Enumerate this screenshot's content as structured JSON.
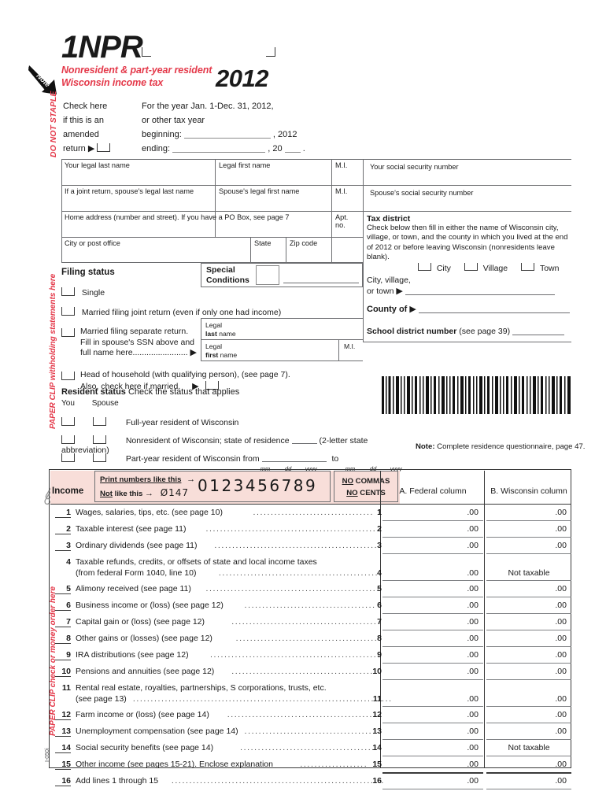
{
  "form": {
    "number": "1NPR",
    "subtitle_line1": "Nonresident & part-year resident",
    "subtitle_line2": "Wisconsin income tax",
    "tax_year": "2012",
    "note_badge": "Note",
    "form_id": "I-050i"
  },
  "margins": {
    "do_not_staple": "DO NOT STAPLE",
    "paper_clip_withholding": "PAPER CLIP withholding statements here",
    "paper_clip_check": "PAPER CLIP check or money order here"
  },
  "amended": {
    "line1": "Check here",
    "line2": "if this is an",
    "line3": "amended",
    "line4": "return"
  },
  "period": {
    "line1": "For the year Jan. 1-Dec. 31, 2012,",
    "line2": "or other tax year",
    "beginning_label": "beginning:",
    "beginning_year": ", 2012",
    "ending_label": "ending:",
    "ending_year": ", 20",
    "ending_period": "."
  },
  "identity": {
    "your_last_name": "Your legal last name",
    "legal_first_name": "Legal first name",
    "mi": "M.I.",
    "spouse_last_name": "If a joint return, spouse's legal last name",
    "spouse_first_name": "Spouse's legal first name",
    "spouse_mi": "M.I.",
    "home_address": "Home address (number and street). If you have a PO Box, see page 7",
    "apt_no": "Apt. no.",
    "city_or_post_office": "City or post office",
    "state": "State",
    "zip_code": "Zip code"
  },
  "ssn": {
    "your_ssn": "Your social security number",
    "spouse_ssn": "Spouse's social security number"
  },
  "tax_district": {
    "title": "Tax district",
    "description": "Check below then fill in either the name of Wisconsin city, village, or town, and the county in which you lived at the end of 2012 or before leaving Wisconsin (nonresidents leave blank).",
    "option_city": "City",
    "option_village": "Village",
    "option_town": "Town",
    "city_village_town_label_line1": "City, village,",
    "city_village_town_label_line2": "or town",
    "county_of": "County of",
    "school_district_label": "School district number",
    "school_district_note": "(see page 39)"
  },
  "filing_status": {
    "title": "Filing status",
    "options": [
      "Single",
      "Married filing joint return (even if only one had income)",
      "Married filing separate return.",
      "Head of household (with qualifying person), (see page 7)."
    ],
    "mfs_line2": "Fill in spouse's SSN above and",
    "mfs_line3": "full name here",
    "mfs_dots": "........................",
    "hoh_line2": "Also, check here if married.",
    "spouse_legal_last_word": "Legal",
    "spouse_last_bold": "last",
    "spouse_last_rest": " name",
    "spouse_legal_first_word": "Legal",
    "spouse_first_bold": "first",
    "spouse_first_rest": " name",
    "spouse_mi": "M.I."
  },
  "special_conditions": {
    "label_line1": "Special",
    "label_line2": "Conditions"
  },
  "resident_status": {
    "title": "Resident status",
    "subtitle": "Check the status that applies",
    "col_you": "You",
    "col_spouse": "Spouse",
    "row_full": "Full-year resident of Wisconsin",
    "row_nonresident": "Nonresident of Wisconsin; state of residence",
    "row_nonresident_suffix": "(2-letter state abbreviation)",
    "row_partyear": "Part-year resident of Wisconsin from",
    "row_partyear_to": "to",
    "date_mm": "mm",
    "date_dd": "dd",
    "date_yyyy": "yyyy",
    "note_bold": "Note:",
    "note_text": " Complete residence questionnaire, page 47."
  },
  "income_header": {
    "section_label": "Income",
    "sample_line1_bold": "Print numbers like this",
    "sample_line2_prefix": "Not",
    "sample_line2_rest": " like this",
    "sample_bad": "Ø147",
    "sample_digits": "0123456789",
    "no_commas_line1_ul": "NO",
    "no_commas_line1_rest": " COMMAS",
    "no_commas_line2_ul": "NO",
    "no_commas_line2_rest": " CENTS",
    "column_a": "A. Federal column",
    "column_b": "B. Wisconsin column"
  },
  "income_rows": [
    {
      "no": "1",
      "text": "Wages, salaries, tips, etc. (see page 10)",
      "a": ".00",
      "b": ".00",
      "lines": 1
    },
    {
      "no": "2",
      "text": "Taxable interest (see page 11)",
      "a": ".00",
      "b": ".00",
      "lines": 1
    },
    {
      "no": "3",
      "text": "Ordinary dividends (see page 11)",
      "a": ".00",
      "b": ".00",
      "lines": 1
    },
    {
      "no": "4",
      "text": "Taxable refunds, credits, or offsets of state and local income taxes",
      "text2": "(from federal Form 1040, line 10)",
      "a": ".00",
      "b": "Not taxable",
      "lines": 2
    },
    {
      "no": "5",
      "text": "Alimony received (see page 11)",
      "a": ".00",
      "b": ".00",
      "lines": 1
    },
    {
      "no": "6",
      "text": "Business income or (loss) (see page 12)",
      "a": ".00",
      "b": ".00",
      "lines": 1
    },
    {
      "no": "7",
      "text": "Capital gain or (loss) (see page 12)",
      "a": ".00",
      "b": ".00",
      "lines": 1
    },
    {
      "no": "8",
      "text": "Other gains or (losses) (see page 12)",
      "a": ".00",
      "b": ".00",
      "lines": 1
    },
    {
      "no": "9",
      "text": "IRA distributions (see page 12)",
      "a": ".00",
      "b": ".00",
      "lines": 1
    },
    {
      "no": "10",
      "text": "Pensions and annuities (see page 12)",
      "a": ".00",
      "b": ".00",
      "lines": 1
    },
    {
      "no": "11",
      "text": "Rental real estate, royalties, partnerships, S corporations, trusts, etc.",
      "text2": "(see page 13)",
      "a": ".00",
      "b": ".00",
      "lines": 2
    },
    {
      "no": "12",
      "text": "Farm income or (loss) (see page 14)",
      "a": ".00",
      "b": ".00",
      "lines": 1
    },
    {
      "no": "13",
      "text": "Unemployment compensation (see page 14)",
      "a": ".00",
      "b": ".00",
      "lines": 1
    },
    {
      "no": "14",
      "text": "Social security benefits (see page 14)",
      "a": ".00",
      "b": "Not taxable",
      "lines": 1
    },
    {
      "no": "15",
      "text": "Other income (see pages 15-21).  Enclose explanation",
      "a": ".00",
      "b": ".00",
      "lines": 1
    },
    {
      "no": "16",
      "text": "Add lines 1 through 15",
      "a": ".00",
      "b": ".00",
      "lines": 1
    }
  ],
  "colors": {
    "accent_red": "#e4394a",
    "pink_fill": "#f8ded9",
    "rule_gray": "#6d6e71"
  }
}
